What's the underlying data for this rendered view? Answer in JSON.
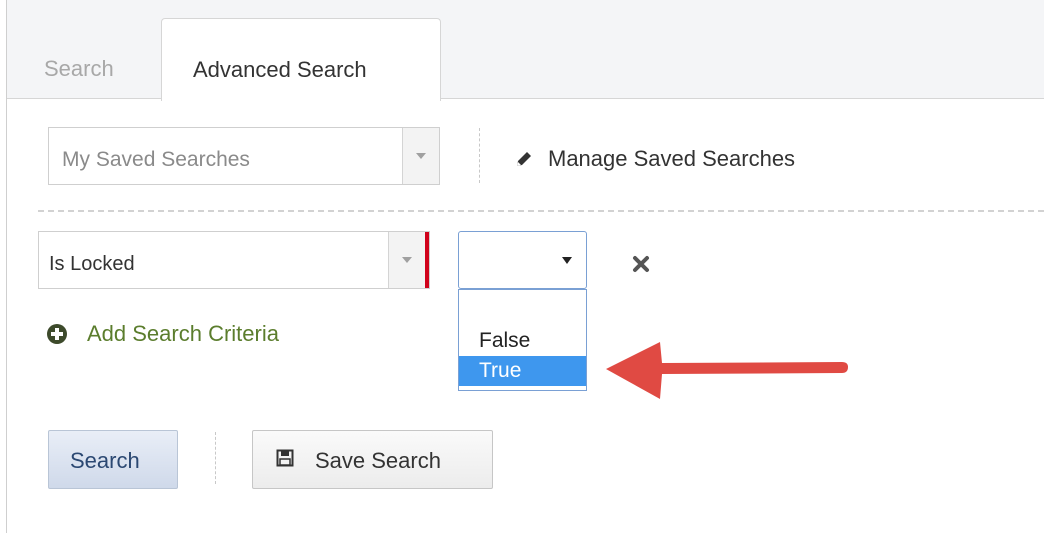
{
  "tabs": [
    "Search",
    "Advanced Search"
  ],
  "saved_searches": {
    "placeholder": "My Saved Searches",
    "manage_label": "Manage Saved Searches"
  },
  "criteria": {
    "field_value": "Is Locked",
    "value_options": [
      "",
      "False",
      "True"
    ],
    "highlighted_option": "True",
    "add_label": "Add Search Criteria"
  },
  "actions": {
    "search_label": "Search",
    "save_label": "Save Search"
  },
  "colors": {
    "accent": "#3e97ee",
    "required": "#d0021b",
    "arrow": "#e04a43",
    "add_text": "#5b7d2d"
  }
}
